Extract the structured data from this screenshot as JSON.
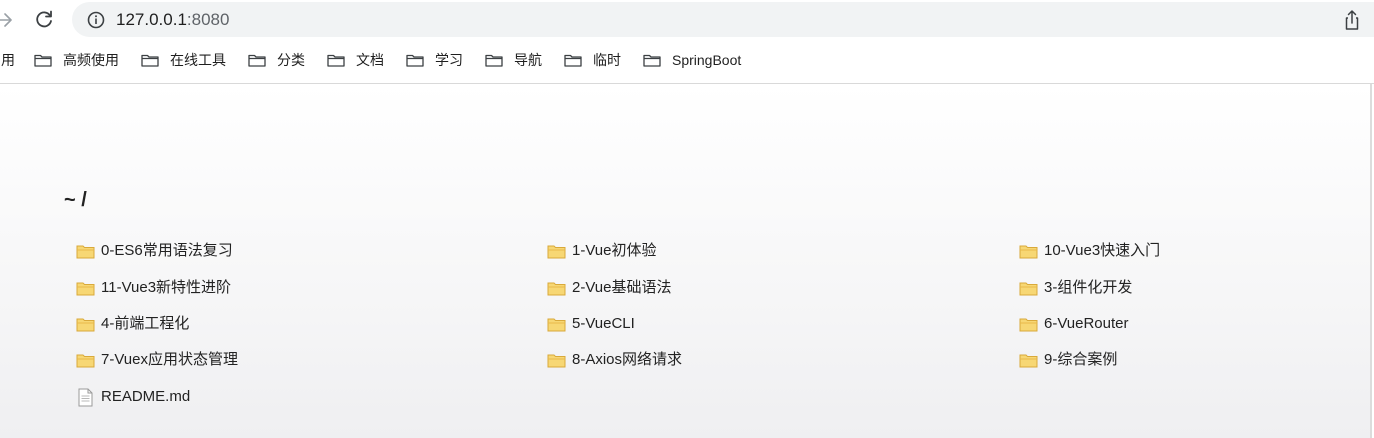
{
  "browser": {
    "url_host": "127.0.0.1",
    "url_port": ":8080",
    "nav_forward_icon": "arrow-right-icon",
    "reload_icon": "reload-icon",
    "info_icon": "info-circle-icon",
    "share_icon": "share-icon"
  },
  "bookmarks": {
    "partial_label": "用",
    "items": [
      {
        "label": "高频使用"
      },
      {
        "label": "在线工具"
      },
      {
        "label": "分类"
      },
      {
        "label": "文档"
      },
      {
        "label": "学习"
      },
      {
        "label": "导航"
      },
      {
        "label": "临时"
      },
      {
        "label": "SpringBoot"
      }
    ]
  },
  "listing": {
    "path": "~ /",
    "entries": [
      {
        "name": "0-ES6常用语法复习",
        "type": "folder"
      },
      {
        "name": "1-Vue初体验",
        "type": "folder"
      },
      {
        "name": "10-Vue3快速入门",
        "type": "folder"
      },
      {
        "name": "11-Vue3新特性进阶",
        "type": "folder"
      },
      {
        "name": "2-Vue基础语法",
        "type": "folder"
      },
      {
        "name": "3-组件化开发",
        "type": "folder"
      },
      {
        "name": "4-前端工程化",
        "type": "folder"
      },
      {
        "name": "5-VueCLI",
        "type": "folder"
      },
      {
        "name": "6-VueRouter",
        "type": "folder"
      },
      {
        "name": "7-Vuex应用状态管理",
        "type": "folder"
      },
      {
        "name": "8-Axios网络请求",
        "type": "folder"
      },
      {
        "name": "9-综合案例",
        "type": "folder"
      },
      {
        "name": "README.md",
        "type": "file"
      }
    ]
  },
  "colors": {
    "folder_fill": "#f7d774",
    "folder_stroke": "#d9a93a",
    "omnibox_bg": "#f1f3f4"
  }
}
